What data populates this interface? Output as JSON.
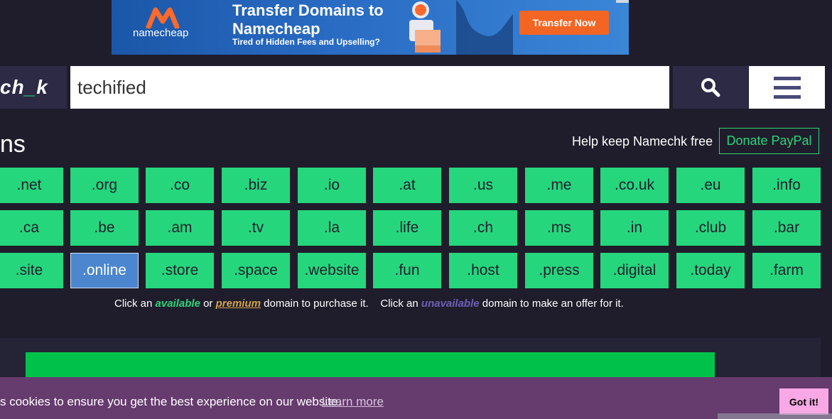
{
  "ad": {
    "brand": "namecheap",
    "headline": "Transfer Domains to Namecheap",
    "subline": "Tired of Hidden Fees and Upselling?",
    "cta": "Transfer Now"
  },
  "header": {
    "logo_prefix": "ch",
    "logo_underscore": "_",
    "logo_suffix": "k",
    "search_value": "techified"
  },
  "section": {
    "title": "ns",
    "help_text": "Help keep Namechk free",
    "donate_label": "Donate PayPal"
  },
  "tlds": {
    "rows": [
      [
        ".net",
        ".org",
        ".co",
        ".biz",
        ".io",
        ".at",
        ".us",
        ".me",
        ".co.uk",
        ".eu",
        ".info"
      ],
      [
        ".ca",
        ".be",
        ".am",
        ".tv",
        ".la",
        ".life",
        ".ch",
        ".ms",
        ".in",
        ".club",
        ".bar"
      ],
      [
        ".site",
        ".online",
        ".store",
        ".space",
        ".website",
        ".fun",
        ".host",
        ".press",
        ".digital",
        ".today",
        ".farm"
      ]
    ],
    "selected": ".online"
  },
  "hint": {
    "p1": "Click an ",
    "available": "available",
    "p2": " or ",
    "premium": "premium",
    "p3": " domain to purchase it.    Click an ",
    "unavailable": "unavailable",
    "p4": " domain to make an offer for it."
  },
  "cookie": {
    "text": "s cookies to ensure you get the best experience on our website.",
    "link": "Learn more",
    "button": "Got it!"
  },
  "colors": {
    "available": "#26d67d",
    "selected": "#4b86cf",
    "background": "#1f1d2b",
    "cookie_bg": "#663b6e"
  }
}
